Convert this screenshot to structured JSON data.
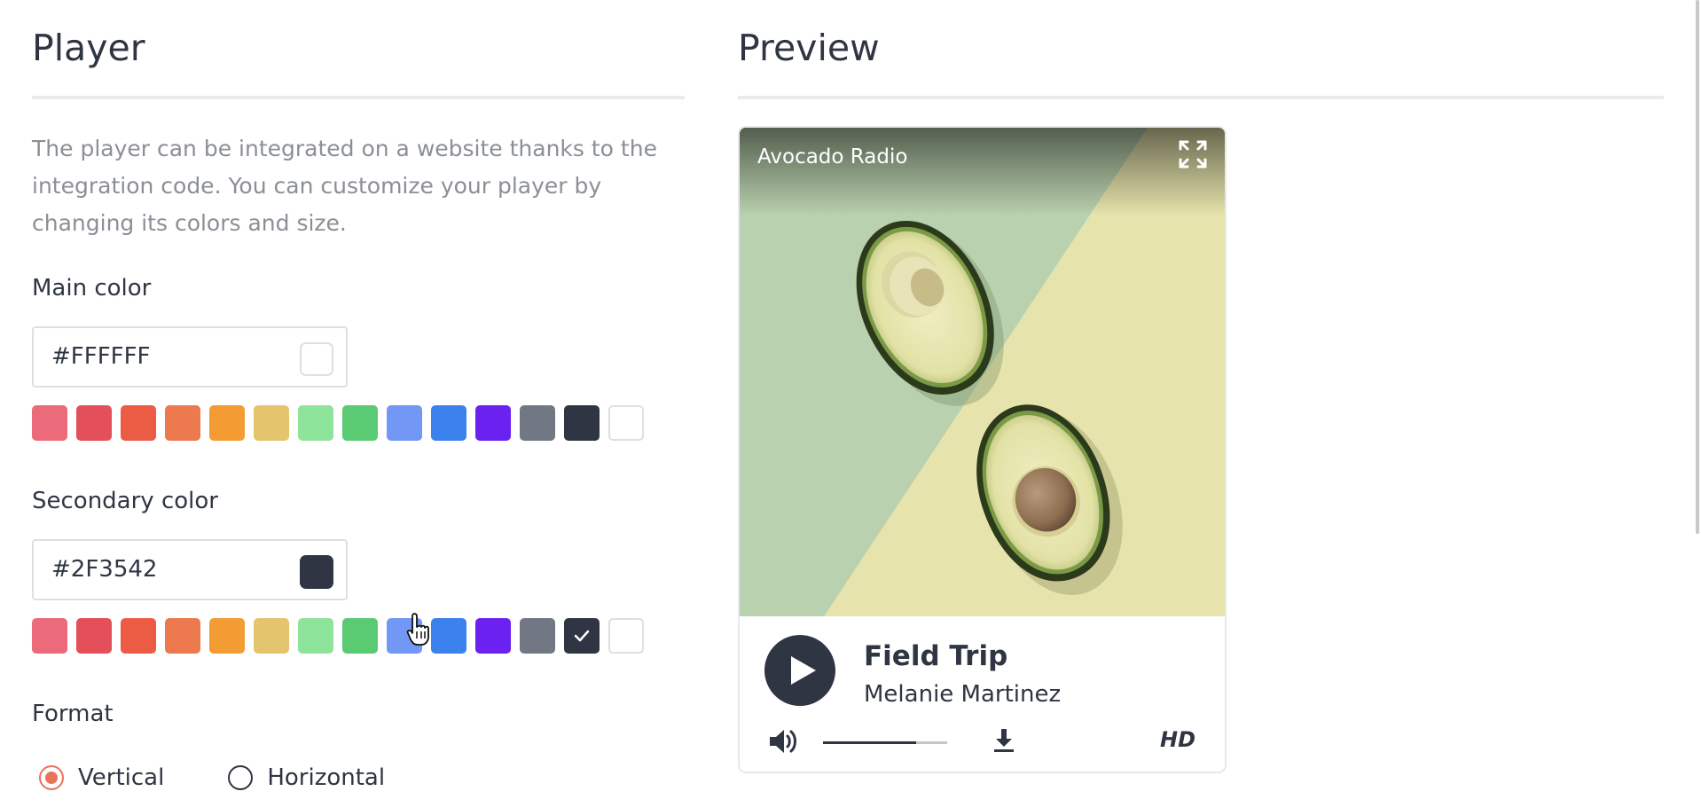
{
  "player": {
    "title": "Player",
    "description": "The player can be integrated on a website thanks to the integration code. You can customize your player by changing its colors and size.",
    "main_color": {
      "label": "Main color",
      "value": "#FFFFFF"
    },
    "secondary_color": {
      "label": "Secondary color",
      "value": "#2F3542",
      "selected_swatch": "#2F3542"
    },
    "palette": [
      "#EC6B7A",
      "#E4505A",
      "#EC5C45",
      "#EC7A4E",
      "#F39C34",
      "#E5C46E",
      "#8FE49C",
      "#5ACA73",
      "#7397F4",
      "#3B82EE",
      "#6B22F0",
      "#727784",
      "#2F3542",
      "#FFFFFF"
    ],
    "format": {
      "label": "Format",
      "options": [
        {
          "label": "Vertical",
          "selected": true
        },
        {
          "label": "Horizontal",
          "selected": false
        }
      ]
    }
  },
  "preview": {
    "title": "Preview",
    "station": "Avocado Radio",
    "track_title": "Field Trip",
    "artist": "Melanie Martinez",
    "quality_badge": "HD",
    "volume_level": 0.75
  },
  "icons": [
    "fullscreen-icon",
    "play-icon",
    "volume-icon",
    "download-icon",
    "check-icon",
    "hand-cursor-icon"
  ]
}
